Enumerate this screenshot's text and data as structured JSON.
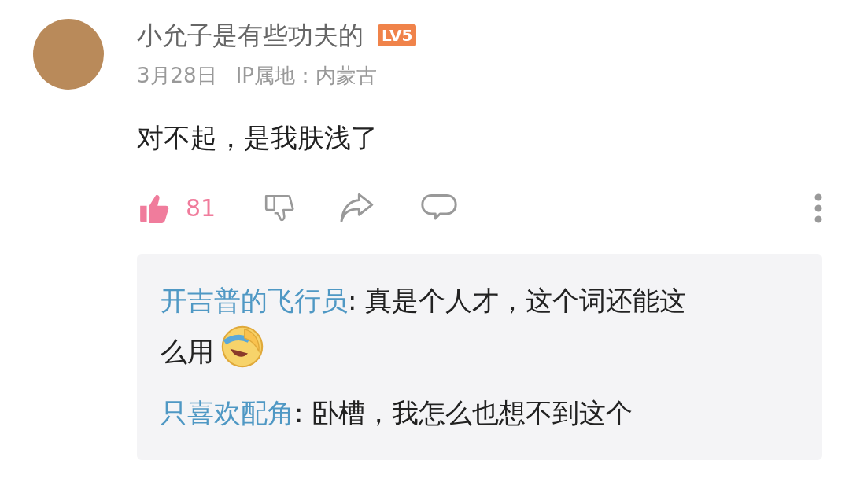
{
  "comment": {
    "author": "小允子是有些功夫的",
    "level": "LV5",
    "date": "3月28日",
    "ip": "IP属地：内蒙古",
    "text": "对不起，是我肤浅了",
    "actions": {
      "liked": true,
      "like_count": "81"
    },
    "replies": [
      {
        "author": "开吉普的飞行员",
        "text": ": 真是个人才，这个词还能这么用",
        "emoji": true
      },
      {
        "author": "只喜欢配角",
        "text": ": 卧槽，我怎么也想不到这个",
        "emoji": false
      }
    ]
  }
}
